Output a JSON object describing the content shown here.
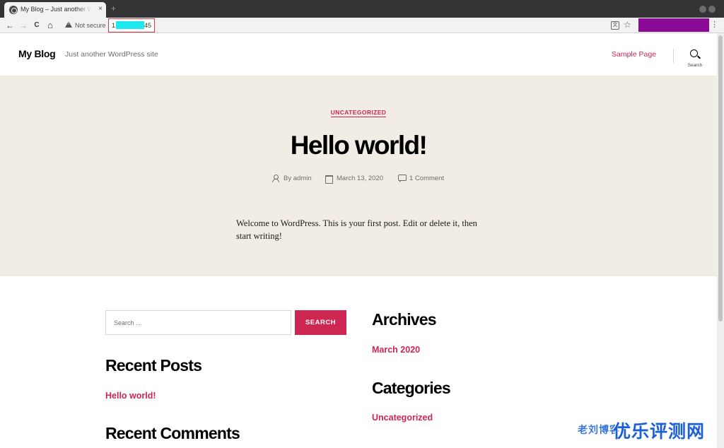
{
  "browser": {
    "tab": {
      "title": "My Blog – Just another WordPress site",
      "close": "×"
    },
    "new_tab": "+",
    "nav": {
      "back": "←",
      "forward": "→",
      "reload": "C",
      "home": "⌂"
    },
    "security_label": "Not secure",
    "url_start": "1",
    "url_end": "45",
    "translate_glyph": "文",
    "bookmark": "☆",
    "menu": "⋮"
  },
  "site": {
    "title": "My Blog",
    "description": "Just another WordPress site",
    "nav_link": "Sample Page",
    "search_toggle_label": "Search"
  },
  "post": {
    "category": "UNCATEGORIZED",
    "title": "Hello world!",
    "author": "By admin",
    "date": "March 13, 2020",
    "comments": "1 Comment",
    "body": "Welcome to WordPress. This is your first post. Edit or delete it, then start writing!"
  },
  "widgets": {
    "search_placeholder": "Search …",
    "search_button": "SEARCH",
    "recent_posts_title": "Recent Posts",
    "recent_posts": [
      "Hello world!"
    ],
    "recent_comments_title": "Recent Comments",
    "archives_title": "Archives",
    "archives": [
      "March 2020"
    ],
    "categories_title": "Categories",
    "categories": [
      "Uncategorized"
    ]
  },
  "watermark": {
    "small": "老刘博客",
    "big": "优乐评测网"
  },
  "colors": {
    "accent": "#cd2653",
    "hero_bg": "#f1ede4",
    "chrome_dark": "#343436",
    "profile": "#8a0a96",
    "url_mask": "#1ee7f0"
  }
}
